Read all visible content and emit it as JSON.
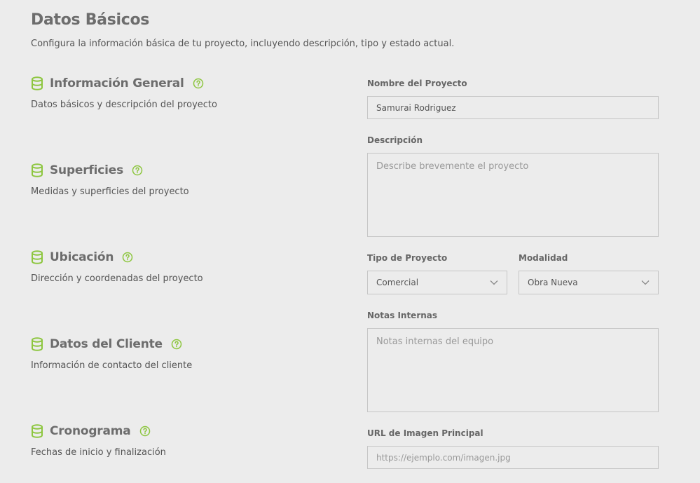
{
  "header": {
    "title": "Datos Básicos",
    "subtitle": "Configura la información básica de tu proyecto, incluyendo descripción, tipo y estado actual."
  },
  "sections": [
    {
      "title": "Información General",
      "description": "Datos básicos y descripción del proyecto",
      "icon": "database-icon"
    },
    {
      "title": "Superficies",
      "description": "Medidas y superficies del proyecto",
      "icon": "database-icon"
    },
    {
      "title": "Ubicación",
      "description": "Dirección y coordenadas del proyecto",
      "icon": "database-icon"
    },
    {
      "title": "Datos del Cliente",
      "description": "Información de contacto del cliente",
      "icon": "database-icon"
    },
    {
      "title": "Cronograma",
      "description": "Fechas de inicio y finalización",
      "icon": "database-icon"
    }
  ],
  "form": {
    "project_name": {
      "label": "Nombre del Proyecto",
      "value": "Samurai Rodriguez"
    },
    "description": {
      "label": "Descripción",
      "placeholder": "Describe brevemente el proyecto",
      "value": ""
    },
    "project_type": {
      "label": "Tipo de Proyecto",
      "value": "Comercial"
    },
    "modality": {
      "label": "Modalidad",
      "value": "Obra Nueva"
    },
    "internal_notes": {
      "label": "Notas Internas",
      "placeholder": "Notas internas del equipo",
      "value": ""
    },
    "image_url": {
      "label": "URL de Imagen Principal",
      "placeholder": "https://ejemplo.com/imagen.jpg",
      "value": ""
    }
  },
  "colors": {
    "accent": "#8dc63f",
    "background": "#ececec",
    "border": "#c6c6c6",
    "title_text": "#6d6d6d"
  },
  "icons": {
    "section": "database-icon",
    "help": "help-circle-icon",
    "dropdown": "chevron-down-icon"
  }
}
